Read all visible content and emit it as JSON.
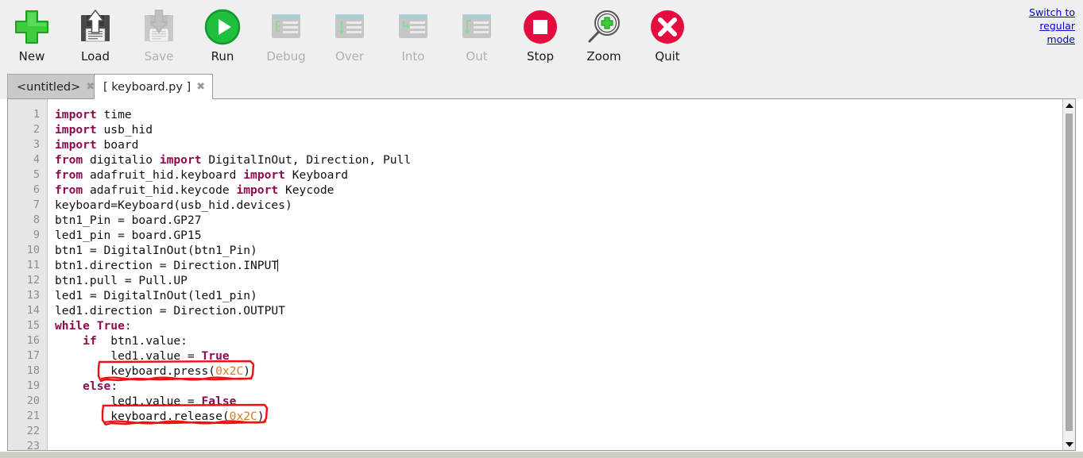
{
  "toolbar": {
    "buttons": [
      {
        "label": "New",
        "icon": "plus-icon",
        "enabled": true
      },
      {
        "label": "Load",
        "icon": "floppy-up-icon",
        "enabled": true
      },
      {
        "label": "Save",
        "icon": "floppy-down-icon",
        "enabled": false
      },
      {
        "label": "Run",
        "icon": "play-icon",
        "enabled": true
      },
      {
        "label": "Debug",
        "icon": "debug-list-icon",
        "enabled": false
      },
      {
        "label": "Over",
        "icon": "step-over-icon",
        "enabled": false
      },
      {
        "label": "Into",
        "icon": "step-into-icon",
        "enabled": false
      },
      {
        "label": "Out",
        "icon": "step-out-icon",
        "enabled": false
      },
      {
        "label": "Stop",
        "icon": "stop-icon",
        "enabled": true
      },
      {
        "label": "Zoom",
        "icon": "magnifier-plus-icon",
        "enabled": true
      },
      {
        "label": "Quit",
        "icon": "close-x-icon",
        "enabled": true
      }
    ],
    "switch_mode_link": "Switch to regular mode"
  },
  "tabs": [
    {
      "label": "<untitled>",
      "close": "✖",
      "active": false
    },
    {
      "label": "[ keyboard.py ]",
      "close": "✖",
      "active": true
    }
  ],
  "editor": {
    "line_numbers": [
      "1",
      "2",
      "3",
      "4",
      "5",
      "6",
      "7",
      "8",
      "9",
      "10",
      "11",
      "12",
      "13",
      "14",
      "15",
      "16",
      "17",
      "18",
      "19",
      "20",
      "21",
      "22",
      "23"
    ],
    "lines": [
      {
        "n": 1,
        "tokens": [
          {
            "t": "import",
            "c": "kw"
          },
          {
            "t": " time",
            "c": ""
          }
        ]
      },
      {
        "n": 2,
        "tokens": [
          {
            "t": "import",
            "c": "kw"
          },
          {
            "t": " usb_hid",
            "c": ""
          }
        ]
      },
      {
        "n": 3,
        "tokens": [
          {
            "t": "import",
            "c": "kw"
          },
          {
            "t": " board",
            "c": ""
          }
        ]
      },
      {
        "n": 4,
        "tokens": [
          {
            "t": "from",
            "c": "kw"
          },
          {
            "t": " digitalio ",
            "c": ""
          },
          {
            "t": "import",
            "c": "kw"
          },
          {
            "t": " DigitalInOut, Direction, Pull",
            "c": ""
          }
        ]
      },
      {
        "n": 5,
        "tokens": [
          {
            "t": "from",
            "c": "kw"
          },
          {
            "t": " adafruit_hid.keyboard ",
            "c": ""
          },
          {
            "t": "import",
            "c": "kw"
          },
          {
            "t": " Keyboard",
            "c": ""
          }
        ]
      },
      {
        "n": 6,
        "tokens": [
          {
            "t": "from",
            "c": "kw"
          },
          {
            "t": " adafruit_hid.keycode ",
            "c": ""
          },
          {
            "t": "import",
            "c": "kw"
          },
          {
            "t": " Keycode",
            "c": ""
          }
        ]
      },
      {
        "n": 7,
        "tokens": [
          {
            "t": "keyboard=Keyboard(usb_hid.devices)",
            "c": ""
          }
        ]
      },
      {
        "n": 8,
        "tokens": [
          {
            "t": "btn1_Pin = board.GP27",
            "c": ""
          }
        ]
      },
      {
        "n": 9,
        "tokens": [
          {
            "t": "led1_pin = board.GP15",
            "c": ""
          }
        ]
      },
      {
        "n": 10,
        "tokens": [
          {
            "t": "btn1 = DigitalInOut(btn1_Pin)",
            "c": ""
          }
        ]
      },
      {
        "n": 11,
        "tokens": [
          {
            "t": "btn1.direction = Direction.INPUT",
            "c": ""
          }
        ],
        "caret": true
      },
      {
        "n": 12,
        "tokens": [
          {
            "t": "btn1.pull = Pull.UP",
            "c": ""
          }
        ]
      },
      {
        "n": 13,
        "tokens": [
          {
            "t": "led1 = DigitalInOut(led1_pin)",
            "c": ""
          }
        ]
      },
      {
        "n": 14,
        "tokens": [
          {
            "t": "led1.direction = Direction.OUTPUT",
            "c": ""
          }
        ]
      },
      {
        "n": 15,
        "tokens": [
          {
            "t": "while",
            "c": "kw"
          },
          {
            "t": " ",
            "c": ""
          },
          {
            "t": "True",
            "c": "kw"
          },
          {
            "t": ":",
            "c": ""
          }
        ]
      },
      {
        "n": 16,
        "tokens": [
          {
            "t": "    ",
            "c": ""
          },
          {
            "t": "if",
            "c": "kw"
          },
          {
            "t": "  btn1.value:",
            "c": ""
          }
        ]
      },
      {
        "n": 17,
        "tokens": [
          {
            "t": "        led1.value = ",
            "c": ""
          },
          {
            "t": "True",
            "c": "kw"
          }
        ]
      },
      {
        "n": 18,
        "tokens": [
          {
            "t": "        keyboard.press(",
            "c": ""
          },
          {
            "t": "0x2C",
            "c": "num"
          },
          {
            "t": ")",
            "c": ""
          }
        ]
      },
      {
        "n": 19,
        "tokens": [
          {
            "t": "    ",
            "c": ""
          },
          {
            "t": "else",
            "c": "kw"
          },
          {
            "t": ":",
            "c": ""
          }
        ]
      },
      {
        "n": 20,
        "tokens": [
          {
            "t": "        led1.value = ",
            "c": ""
          },
          {
            "t": "False",
            "c": "kw"
          }
        ]
      },
      {
        "n": 21,
        "tokens": [
          {
            "t": "        keyboard.release(",
            "c": ""
          },
          {
            "t": "0x2C",
            "c": "num"
          },
          {
            "t": ")",
            "c": ""
          }
        ]
      },
      {
        "n": 22,
        "tokens": []
      },
      {
        "n": 23,
        "tokens": []
      }
    ]
  },
  "annotations": [
    {
      "name": "highlight-keyboard-press",
      "shape": "hand-drawn-rectangle",
      "color": "#ee1111",
      "target_line": 18
    },
    {
      "name": "highlight-keyboard-release",
      "shape": "hand-drawn-rectangle",
      "color": "#ee1111",
      "target_line": 21
    }
  ],
  "colors": {
    "toolbar_bg": "#efefef",
    "keyword": "#8e0a4e",
    "number_literal": "#d97a1a",
    "annotation_red": "#ee1111",
    "link_blue": "#0000d0",
    "active_tab_bg": "#ffffff",
    "inactive_tab_bg": "#c9c9c9",
    "gutter_bg": "#e6e6e6"
  },
  "scrollbars": {
    "vertical_up_arrow": "▲",
    "vertical_down_arrow": "▼"
  }
}
